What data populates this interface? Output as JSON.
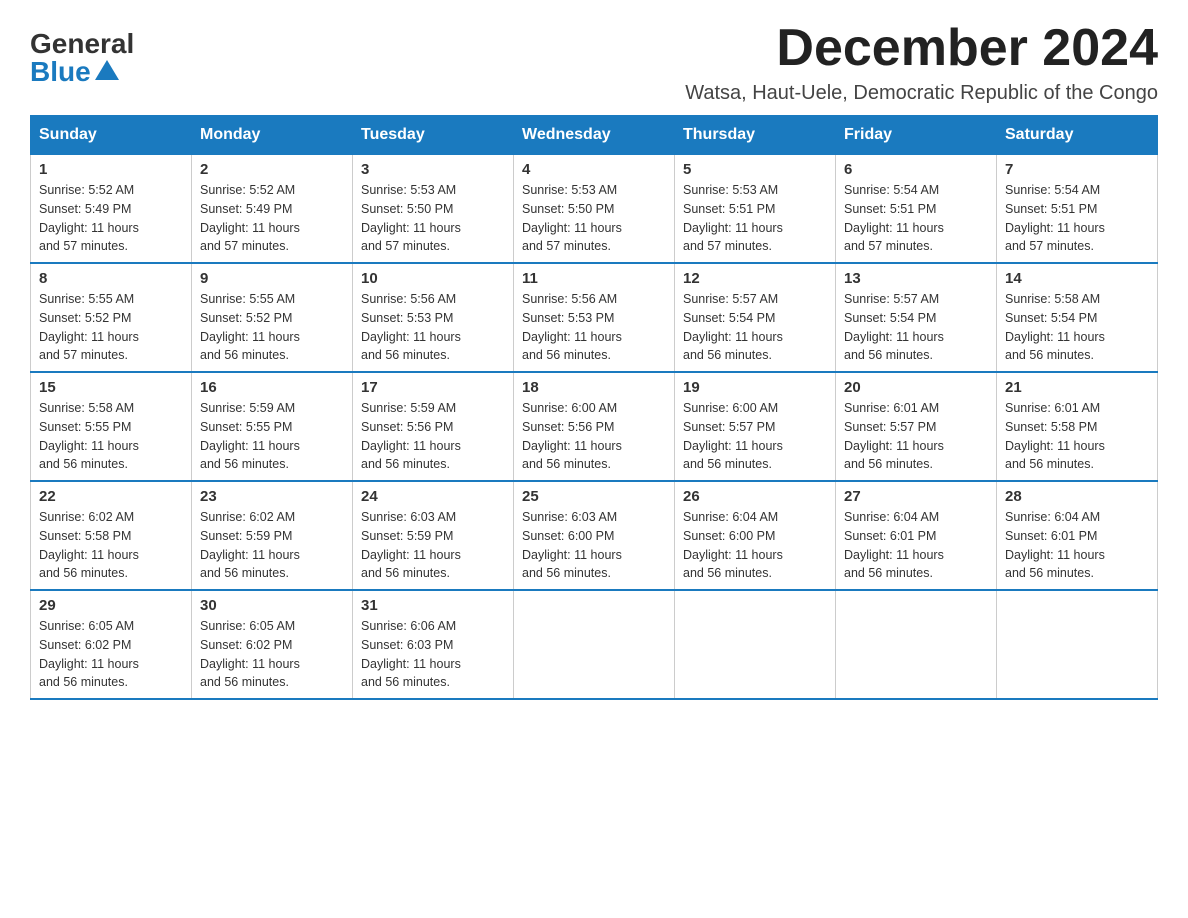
{
  "logo": {
    "general": "General",
    "blue": "Blue"
  },
  "title": "December 2024",
  "location": "Watsa, Haut-Uele, Democratic Republic of the Congo",
  "days_of_week": [
    "Sunday",
    "Monday",
    "Tuesday",
    "Wednesday",
    "Thursday",
    "Friday",
    "Saturday"
  ],
  "weeks": [
    [
      {
        "day": "1",
        "sunrise": "5:52 AM",
        "sunset": "5:49 PM",
        "daylight": "11 hours and 57 minutes."
      },
      {
        "day": "2",
        "sunrise": "5:52 AM",
        "sunset": "5:49 PM",
        "daylight": "11 hours and 57 minutes."
      },
      {
        "day": "3",
        "sunrise": "5:53 AM",
        "sunset": "5:50 PM",
        "daylight": "11 hours and 57 minutes."
      },
      {
        "day": "4",
        "sunrise": "5:53 AM",
        "sunset": "5:50 PM",
        "daylight": "11 hours and 57 minutes."
      },
      {
        "day": "5",
        "sunrise": "5:53 AM",
        "sunset": "5:51 PM",
        "daylight": "11 hours and 57 minutes."
      },
      {
        "day": "6",
        "sunrise": "5:54 AM",
        "sunset": "5:51 PM",
        "daylight": "11 hours and 57 minutes."
      },
      {
        "day": "7",
        "sunrise": "5:54 AM",
        "sunset": "5:51 PM",
        "daylight": "11 hours and 57 minutes."
      }
    ],
    [
      {
        "day": "8",
        "sunrise": "5:55 AM",
        "sunset": "5:52 PM",
        "daylight": "11 hours and 57 minutes."
      },
      {
        "day": "9",
        "sunrise": "5:55 AM",
        "sunset": "5:52 PM",
        "daylight": "11 hours and 56 minutes."
      },
      {
        "day": "10",
        "sunrise": "5:56 AM",
        "sunset": "5:53 PM",
        "daylight": "11 hours and 56 minutes."
      },
      {
        "day": "11",
        "sunrise": "5:56 AM",
        "sunset": "5:53 PM",
        "daylight": "11 hours and 56 minutes."
      },
      {
        "day": "12",
        "sunrise": "5:57 AM",
        "sunset": "5:54 PM",
        "daylight": "11 hours and 56 minutes."
      },
      {
        "day": "13",
        "sunrise": "5:57 AM",
        "sunset": "5:54 PM",
        "daylight": "11 hours and 56 minutes."
      },
      {
        "day": "14",
        "sunrise": "5:58 AM",
        "sunset": "5:54 PM",
        "daylight": "11 hours and 56 minutes."
      }
    ],
    [
      {
        "day": "15",
        "sunrise": "5:58 AM",
        "sunset": "5:55 PM",
        "daylight": "11 hours and 56 minutes."
      },
      {
        "day": "16",
        "sunrise": "5:59 AM",
        "sunset": "5:55 PM",
        "daylight": "11 hours and 56 minutes."
      },
      {
        "day": "17",
        "sunrise": "5:59 AM",
        "sunset": "5:56 PM",
        "daylight": "11 hours and 56 minutes."
      },
      {
        "day": "18",
        "sunrise": "6:00 AM",
        "sunset": "5:56 PM",
        "daylight": "11 hours and 56 minutes."
      },
      {
        "day": "19",
        "sunrise": "6:00 AM",
        "sunset": "5:57 PM",
        "daylight": "11 hours and 56 minutes."
      },
      {
        "day": "20",
        "sunrise": "6:01 AM",
        "sunset": "5:57 PM",
        "daylight": "11 hours and 56 minutes."
      },
      {
        "day": "21",
        "sunrise": "6:01 AM",
        "sunset": "5:58 PM",
        "daylight": "11 hours and 56 minutes."
      }
    ],
    [
      {
        "day": "22",
        "sunrise": "6:02 AM",
        "sunset": "5:58 PM",
        "daylight": "11 hours and 56 minutes."
      },
      {
        "day": "23",
        "sunrise": "6:02 AM",
        "sunset": "5:59 PM",
        "daylight": "11 hours and 56 minutes."
      },
      {
        "day": "24",
        "sunrise": "6:03 AM",
        "sunset": "5:59 PM",
        "daylight": "11 hours and 56 minutes."
      },
      {
        "day": "25",
        "sunrise": "6:03 AM",
        "sunset": "6:00 PM",
        "daylight": "11 hours and 56 minutes."
      },
      {
        "day": "26",
        "sunrise": "6:04 AM",
        "sunset": "6:00 PM",
        "daylight": "11 hours and 56 minutes."
      },
      {
        "day": "27",
        "sunrise": "6:04 AM",
        "sunset": "6:01 PM",
        "daylight": "11 hours and 56 minutes."
      },
      {
        "day": "28",
        "sunrise": "6:04 AM",
        "sunset": "6:01 PM",
        "daylight": "11 hours and 56 minutes."
      }
    ],
    [
      {
        "day": "29",
        "sunrise": "6:05 AM",
        "sunset": "6:02 PM",
        "daylight": "11 hours and 56 minutes."
      },
      {
        "day": "30",
        "sunrise": "6:05 AM",
        "sunset": "6:02 PM",
        "daylight": "11 hours and 56 minutes."
      },
      {
        "day": "31",
        "sunrise": "6:06 AM",
        "sunset": "6:03 PM",
        "daylight": "11 hours and 56 minutes."
      },
      null,
      null,
      null,
      null
    ]
  ],
  "labels": {
    "sunrise": "Sunrise:",
    "sunset": "Sunset:",
    "daylight": "Daylight:"
  }
}
